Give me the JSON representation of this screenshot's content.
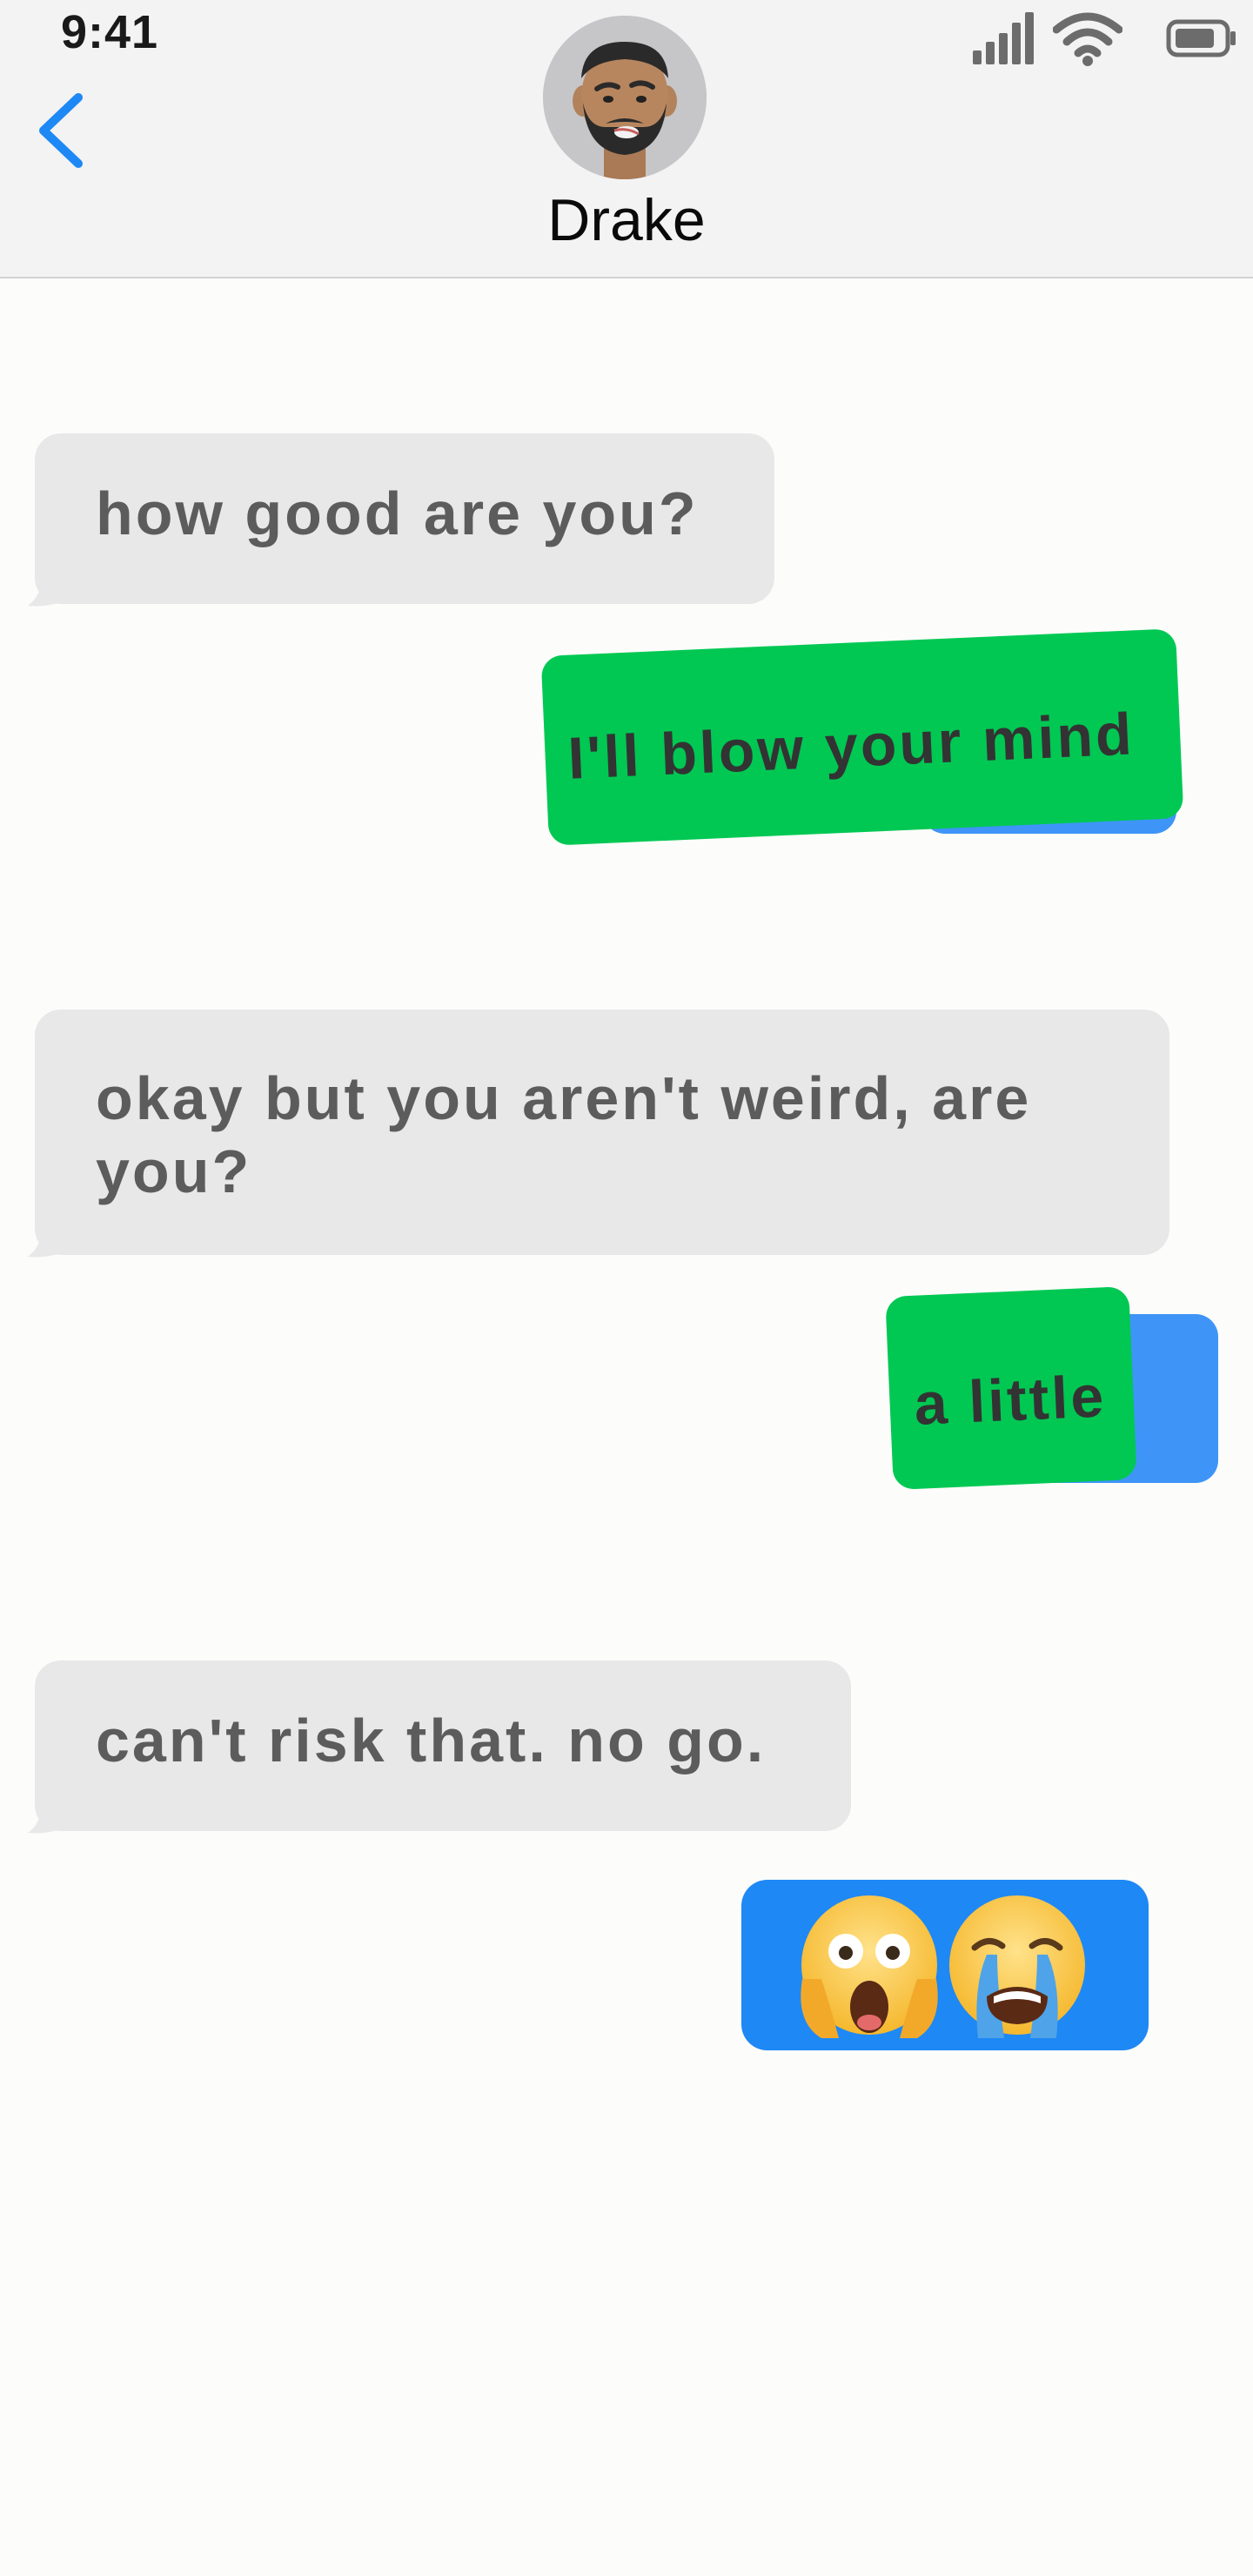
{
  "status_bar": {
    "time": "9:41",
    "signal_icon": "cellular-signal-icon",
    "wifi_icon": "wifi-icon",
    "battery_icon": "battery-icon"
  },
  "header": {
    "back_icon": "chevron-left-icon",
    "contact_name": "Drake",
    "avatar": "drake-avatar"
  },
  "messages": [
    {
      "side": "received",
      "text": "how good are you?"
    },
    {
      "side": "sent",
      "text": "I'll blow your mind"
    },
    {
      "side": "received",
      "text": "okay but you aren't weird, are you?"
    },
    {
      "side": "sent",
      "text": "a little"
    },
    {
      "side": "received",
      "text": "can't risk that. no go."
    },
    {
      "side": "sent",
      "text": "",
      "emojis": [
        "face-screaming-emoji",
        "loudly-crying-emoji"
      ]
    }
  ],
  "colors": {
    "accent_blue": "#1E88F5",
    "sent_green": "#00C853",
    "received_gray": "#E8E8E9"
  }
}
